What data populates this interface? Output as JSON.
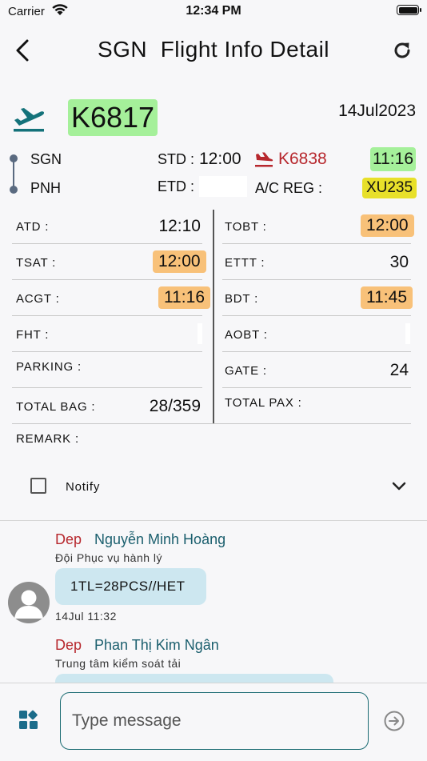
{
  "status_bar": {
    "carrier": "Carrier",
    "time": "12:34 PM"
  },
  "header": {
    "title": "SGN  Flight Info Detail"
  },
  "flight": {
    "number": "K6817",
    "date": "14Jul2023",
    "origin": "SGN",
    "destination": "PNH",
    "std_label": "STD :",
    "std_value": "12:00",
    "etd_label": "ETD :",
    "arrival_flight": "K6838",
    "arrival_time": "11:16",
    "acreg_label": "A/C REG :",
    "acreg_value": "XU235"
  },
  "colors": {
    "green_badge": "#a5f09a",
    "orange_badge": "#f8c179",
    "yellow_badge": "#e8e02a",
    "red_accent": "#b7282e",
    "teal_accent": "#1b5f6e",
    "bubble": "#cde7f0"
  },
  "fields": {
    "left": [
      {
        "label": "ATD :",
        "value": "12:10"
      },
      {
        "label": "TSAT :",
        "value": "12:00"
      },
      {
        "label": "ACGT :",
        "value": "11:16"
      },
      {
        "label": "FHT :",
        "value": ""
      },
      {
        "label": "PARKING :",
        "value": ""
      },
      {
        "label": "TOTAL BAG :",
        "value": "28/359"
      }
    ],
    "right": [
      {
        "label": "TOBT :",
        "value": "12:00"
      },
      {
        "label": "ETTT :",
        "value": "30"
      },
      {
        "label": "BDT :",
        "value": "11:45"
      },
      {
        "label": "AOBT :",
        "value": ""
      },
      {
        "label": "GATE :",
        "value": "24"
      },
      {
        "label": "TOTAL PAX :",
        "value": ""
      }
    ],
    "remark_label": "REMARK :"
  },
  "notify": {
    "label": "Notify"
  },
  "messages": [
    {
      "tag": "Dep",
      "name": "Nguyễn Minh Hoàng",
      "department": "Đội Phục vụ hành lý",
      "text": "1TL=28PCS//HET",
      "time": "14Jul 11:32"
    },
    {
      "tag": "Dep",
      "name": "Phan Thị Kim Ngân",
      "department": "Trung tâm kiểm soát tải"
    }
  ],
  "composer": {
    "placeholder": "Type message"
  },
  "icons": {
    "back": "chevron-left-icon",
    "refresh": "refresh-icon",
    "departure": "plane-departure-icon",
    "arrival": "plane-arrival-icon",
    "expand": "chevron-down-icon",
    "avatar": "user-avatar-icon",
    "apps": "apps-grid-icon",
    "send": "send-arrow-icon"
  }
}
